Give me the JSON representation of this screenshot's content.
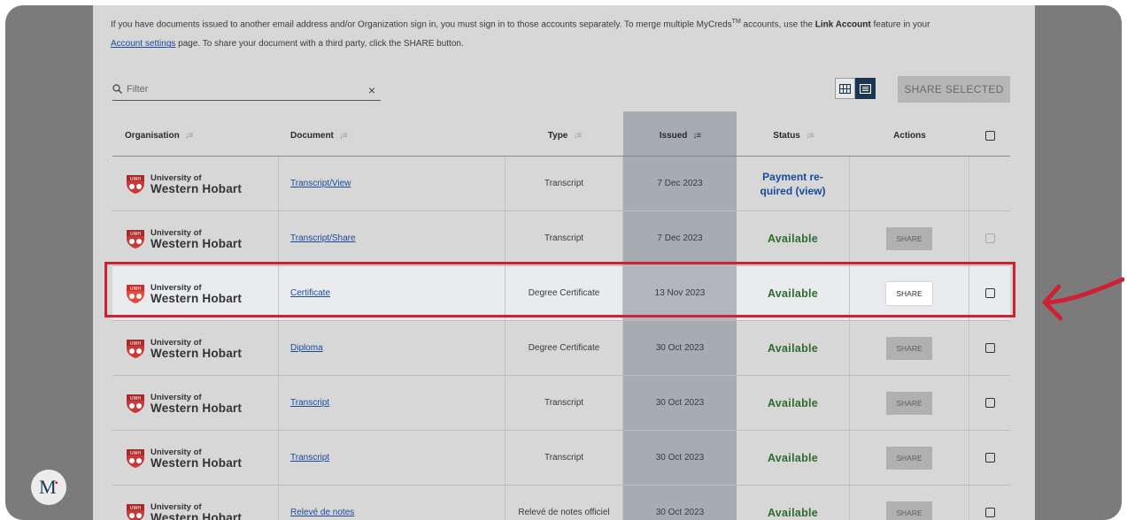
{
  "intro": {
    "line1_a": "If you have documents issued to another email address and/or Organization sign in, you must sign in to those accounts separately. To merge multiple MyCreds",
    "tm": "TM",
    "line1_b": " accounts, use the ",
    "link_account": "Link Account",
    "line1_c": " feature in your",
    "account_settings": "Account settings",
    "line2": " page. To share your document with a third party, click the SHARE button."
  },
  "filter": {
    "placeholder": "Filter",
    "clear": "×"
  },
  "toolbar": {
    "share_selected": "SHARE SELECTED"
  },
  "columns": {
    "organisation": "Organisation",
    "document": "Document",
    "type": "Type",
    "issued": "Issued",
    "status": "Status",
    "actions": "Actions"
  },
  "org": {
    "line1": "University of",
    "line2": "Western Hobart",
    "badge": "UWH"
  },
  "share_label": "SHARE",
  "rows": [
    {
      "document": "Transcript/View",
      "type": "Transcript",
      "issued": "7 Dec 2023",
      "status_line1": "Payment re-",
      "status_line2": "quired (view)"
    },
    {
      "document": "Transcript/Share",
      "type": "Transcript",
      "issued": "7 Dec 2023",
      "status": "Available"
    },
    {
      "document": "Certificate",
      "type": "Degree Certificate",
      "issued": "13 Nov 2023",
      "status": "Available"
    },
    {
      "document": "Diploma",
      "type": "Degree Certificate",
      "issued": "30 Oct 2023",
      "status": "Available"
    },
    {
      "document": "Transcript",
      "type": "Transcript",
      "issued": "30 Oct 2023",
      "status": "Available"
    },
    {
      "document": "Transcript",
      "type": "Transcript",
      "issued": "30 Oct 2023",
      "status": "Available"
    },
    {
      "document": "Relevé de notes",
      "type": "Relevé de notes officiel",
      "issued": "30 Oct 2023",
      "status": "Available"
    }
  ],
  "colors": {
    "highlight": "#cc2233",
    "status_ok": "#2e6b2e",
    "link": "#1a4a9a",
    "toggle_active": "#1b3552"
  },
  "brand": {
    "mark": "M"
  }
}
